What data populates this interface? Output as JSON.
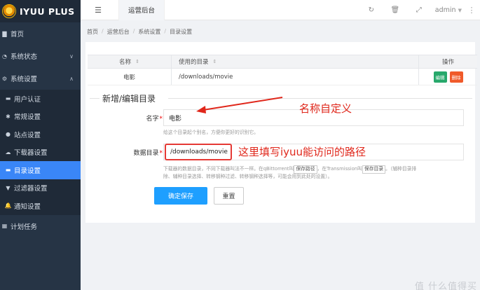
{
  "brand": {
    "name": "IYUU PLUS"
  },
  "sidebar": {
    "items": [
      {
        "label": "首页",
        "icon": "home-icon",
        "glyph": "▇"
      },
      {
        "label": "系统状态",
        "icon": "dashboard-icon",
        "glyph": "◔",
        "caret": "∨"
      },
      {
        "label": "系统设置",
        "icon": "settings-icon",
        "glyph": "⚙",
        "caret": "∧"
      },
      {
        "label": "用户认证",
        "icon": "id-card-icon",
        "glyph": "▬"
      },
      {
        "label": "常规设置",
        "icon": "gear-icon",
        "glyph": "✱"
      },
      {
        "label": "站点设置",
        "icon": "globe-icon",
        "glyph": "●"
      },
      {
        "label": "下载器设置",
        "icon": "cloud-download-icon",
        "glyph": "☁"
      },
      {
        "label": "目录设置",
        "icon": "folder-icon",
        "glyph": "▬"
      },
      {
        "label": "过滤器设置",
        "icon": "filter-icon",
        "glyph": "▼"
      },
      {
        "label": "通知设置",
        "icon": "bell-icon",
        "glyph": "🔔"
      },
      {
        "label": "计划任务",
        "icon": "calendar-icon",
        "glyph": "▦"
      }
    ]
  },
  "header": {
    "menu_glyph": "☰",
    "tab": "运营后台",
    "tools": {
      "refresh": "↻",
      "clear": "🗑",
      "fullscreen": "⤢"
    },
    "user": "admin",
    "user_caret": "▼",
    "more": "⋮"
  },
  "breadcrumb": [
    "首页",
    "运营后台",
    "系统设置",
    "目录设置"
  ],
  "table": {
    "columns": [
      "名称",
      "使用的目录",
      "操作"
    ],
    "sort_glyph": "⇕",
    "rows": [
      {
        "name": "电影",
        "dir": "/downloads/movie",
        "edit": "编辑",
        "delete": "删除"
      }
    ]
  },
  "form": {
    "legend": "新增/编辑目录",
    "name_label": "名字",
    "name_value": "电影",
    "name_hint": "给这个目录起个别名，方便你更好的识别它。",
    "dir_label": "数据目录",
    "dir_value": "/downloads/movie",
    "dir_hint_1a": "下载器的数据目录，不同下载器叫法不一样。在qBittorrent叫",
    "dir_hint_kbd1": "保存路径",
    "dir_hint_1b": "，在Transmission叫",
    "dir_hint_kbd2": "保存目录",
    "dir_hint_1c": "。（辅种目录排",
    "dir_hint_2": "除、辅种目录选择、转移钢种过滤、转移钢种选择等，可能会用到此处的设置）。",
    "required_mark": "*",
    "save": "确定保存",
    "reset": "重置"
  },
  "annotations": {
    "name": "名称自定义",
    "dir": "这里填写iyuu能访问的路径",
    "color": "#e0271b"
  },
  "watermark": "值 什么值得买"
}
